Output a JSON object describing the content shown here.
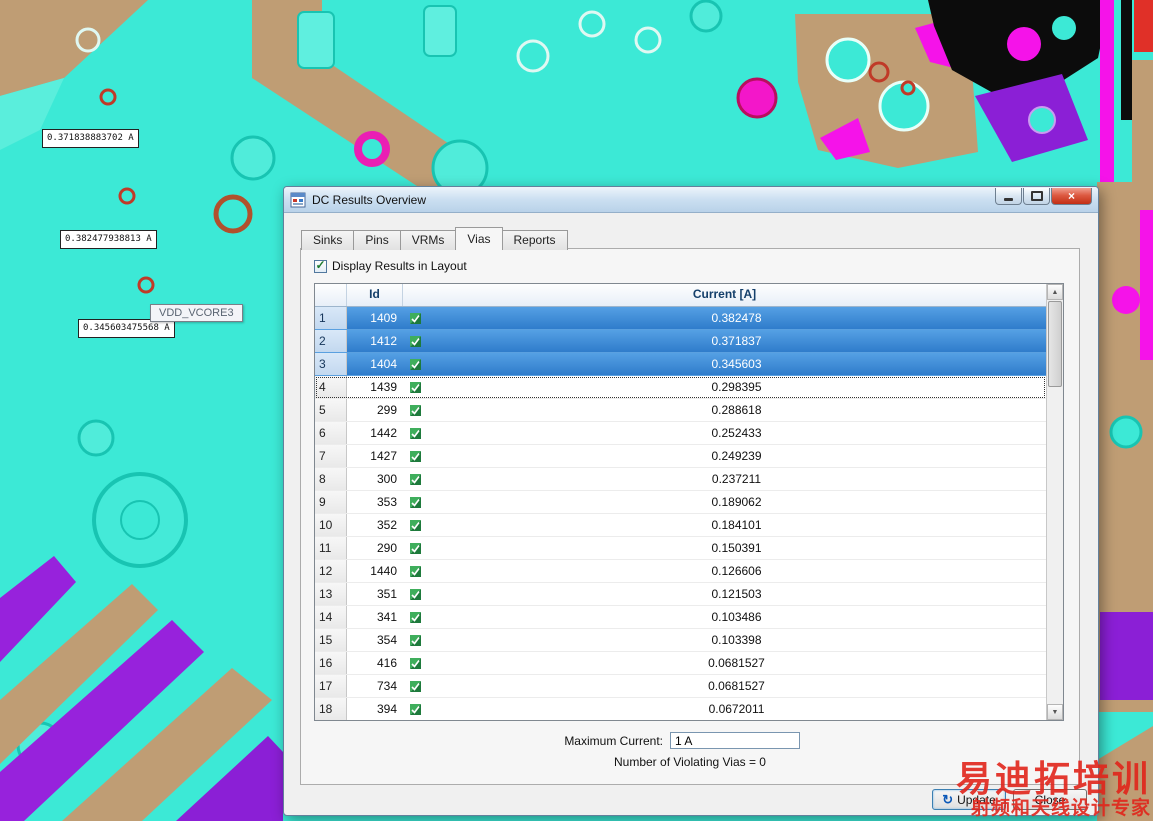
{
  "window": {
    "title": "DC Results Overview",
    "tabs": [
      {
        "label": "Sinks",
        "active": false
      },
      {
        "label": "Pins",
        "active": false
      },
      {
        "label": "VRMs",
        "active": false
      },
      {
        "label": "Vias",
        "active": true
      },
      {
        "label": "Reports",
        "active": false
      }
    ],
    "display_checkbox": {
      "label": "Display Results in Layout",
      "checked": true
    },
    "table": {
      "columns": {
        "id": "Id",
        "current": "Current [A]"
      },
      "rows": [
        {
          "num": "1",
          "id": "1409",
          "current": "0.382478",
          "selected": true
        },
        {
          "num": "2",
          "id": "1412",
          "current": "0.371837",
          "selected": true
        },
        {
          "num": "3",
          "id": "1404",
          "current": "0.345603",
          "selected": true
        },
        {
          "num": "4",
          "id": "1439",
          "current": "0.298395",
          "focused": true
        },
        {
          "num": "5",
          "id": "299",
          "current": "0.288618"
        },
        {
          "num": "6",
          "id": "1442",
          "current": "0.252433"
        },
        {
          "num": "7",
          "id": "1427",
          "current": "0.249239"
        },
        {
          "num": "8",
          "id": "300",
          "current": "0.237211"
        },
        {
          "num": "9",
          "id": "353",
          "current": "0.189062"
        },
        {
          "num": "10",
          "id": "352",
          "current": "0.184101"
        },
        {
          "num": "11",
          "id": "290",
          "current": "0.150391"
        },
        {
          "num": "12",
          "id": "1440",
          "current": "0.126606"
        },
        {
          "num": "13",
          "id": "351",
          "current": "0.121503"
        },
        {
          "num": "14",
          "id": "341",
          "current": "0.103486"
        },
        {
          "num": "15",
          "id": "354",
          "current": "0.103398"
        },
        {
          "num": "16",
          "id": "416",
          "current": "0.0681527"
        },
        {
          "num": "17",
          "id": "734",
          "current": "0.0681527"
        },
        {
          "num": "18",
          "id": "394",
          "current": "0.0672011"
        }
      ]
    },
    "max_current": {
      "label": "Maximum Current:",
      "value": "1 A"
    },
    "violations_text": "Number of Violating Vias = 0",
    "buttons": {
      "update": "Update",
      "close": "Close"
    }
  },
  "layout": {
    "labels": [
      {
        "text": "0.371838883702 A"
      },
      {
        "text": "0.382477938813 A"
      },
      {
        "text": "0.345603475568 A"
      }
    ],
    "tooltip": "VDD_VCORE3"
  },
  "icons": {
    "check": "✓",
    "scroll_up": "▲",
    "scroll_down": "▼",
    "update": "↻",
    "close": "×"
  },
  "colors": {
    "selection": "#2F7CCB",
    "layout_cyan": "#3CE9D6",
    "layout_tan": "#BF9D74",
    "layout_magenta": "#F513E9",
    "watermark_red": "#E1251B"
  },
  "watermark": {
    "line1": "易迪拓培训",
    "line2": "射频和天线设计专家"
  }
}
